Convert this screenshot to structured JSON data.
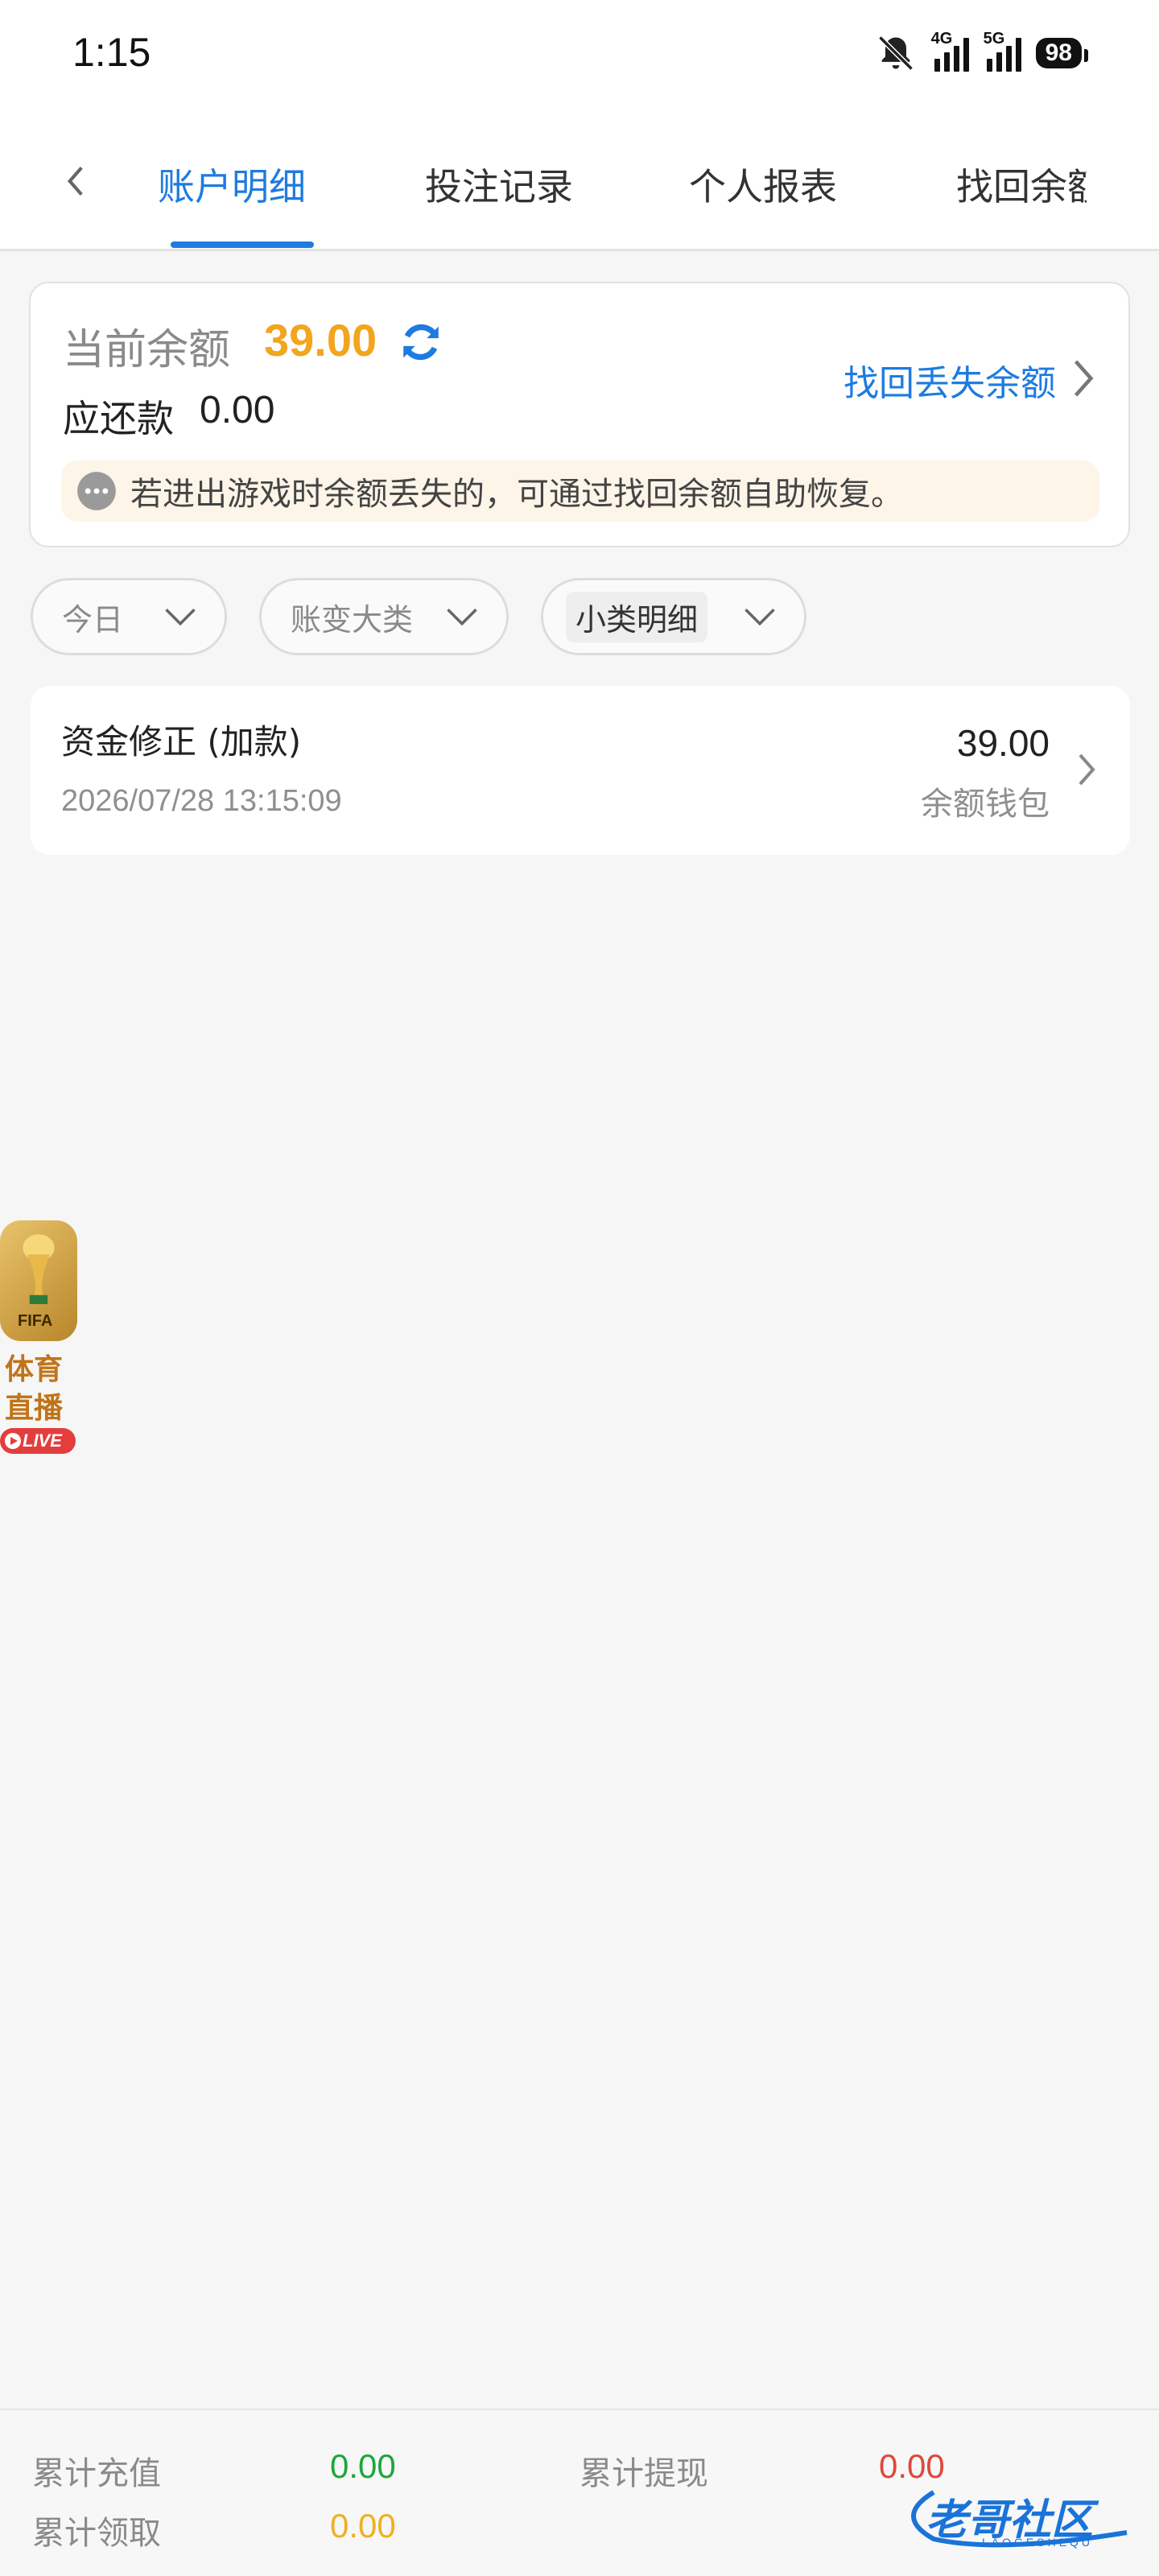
{
  "status_bar": {
    "time": "1:15",
    "net1": "4G",
    "net2": "5G",
    "battery": "98"
  },
  "tabs": {
    "items": [
      {
        "label": "账户明细"
      },
      {
        "label": "投注记录"
      },
      {
        "label": "个人报表"
      },
      {
        "label": "找回余额"
      }
    ]
  },
  "balance": {
    "label": "当前余额",
    "value": "39.00",
    "owed_label": "应还款",
    "owed_value": "0.00",
    "recover_link": "找回丢失余额",
    "notice": "若进出游戏时余额丢失的，可通过找回余额自助恢复。"
  },
  "filters": [
    {
      "label": "今日"
    },
    {
      "label": "账变大类"
    },
    {
      "label": "小类明细"
    }
  ],
  "records": [
    {
      "title": "资金修正 (加款)",
      "time": "2026/07/28 13:15:09",
      "amount": "39.00",
      "wallet": "余额钱包"
    }
  ],
  "live_float": {
    "fifa": "FIFA",
    "line1": "体育",
    "line2": "直播",
    "badge": "LIVE"
  },
  "summary": {
    "recharge_label": "累计充值",
    "recharge_value": "0.00",
    "withdraw_label": "累计提现",
    "withdraw_value": "0.00",
    "claim_label": "累计领取",
    "claim_value": "0.00"
  },
  "watermark": {
    "text": "老哥社区",
    "sub": "LAOGESHEQU"
  },
  "colors": {
    "accent": "#1e7be0",
    "balance": "#f2a51d",
    "green": "#1aa83a",
    "red": "#e0473a",
    "yellow": "#f0b020"
  }
}
